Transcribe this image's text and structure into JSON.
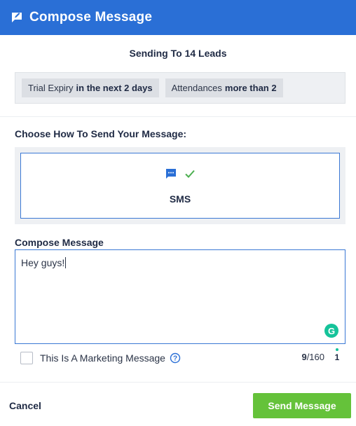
{
  "header": {
    "title": "Compose Message",
    "icon": "compose-icon"
  },
  "sending_to": "Sending To 14 Leads",
  "filters": [
    {
      "label": "Trial Expiry",
      "value": "in the next 2 days"
    },
    {
      "label": "Attendances",
      "value": "more than 2"
    }
  ],
  "method": {
    "heading": "Choose How To Send Your Message:",
    "selected": {
      "label": "SMS",
      "icon": "chat-bubble-icon",
      "check_icon": "checkmark-icon"
    }
  },
  "compose": {
    "label": "Compose Message",
    "value": "Hey guys!"
  },
  "marketing": {
    "label": "This Is A Marketing Message",
    "checked": false
  },
  "counter": {
    "current": "9",
    "limit": "/160",
    "segments": "1"
  },
  "footer": {
    "cancel_label": "Cancel",
    "send_label": "Send Message"
  },
  "colors": {
    "header": "#2a6fd6",
    "accent": "#3a78d4",
    "send": "#65c23a",
    "grammarly": "#15c39a"
  }
}
